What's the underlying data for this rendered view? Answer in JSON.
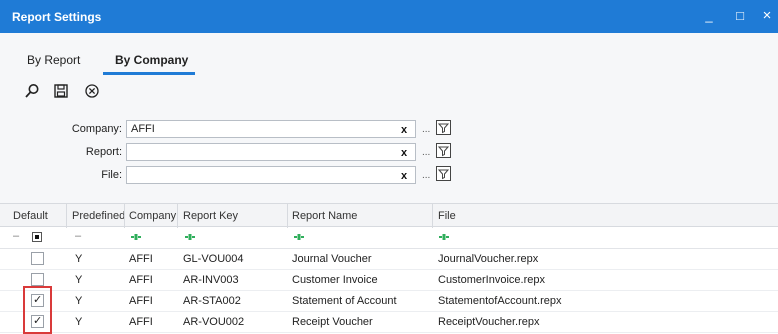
{
  "window": {
    "title": "Report Settings",
    "controls": {
      "minimize": "_",
      "maximize": "□",
      "close": "×"
    }
  },
  "tabs": [
    {
      "label": "By Report",
      "active": false
    },
    {
      "label": "By Company",
      "active": true
    }
  ],
  "toolbar": {
    "icons": [
      "search-icon",
      "save-icon",
      "cancel-icon"
    ]
  },
  "form": {
    "company": {
      "label": "Company:",
      "value": "AFFI"
    },
    "report": {
      "label": "Report:",
      "value": ""
    },
    "file": {
      "label": "File:",
      "value": ""
    },
    "clear_label": "x",
    "dots_label": "..."
  },
  "grid": {
    "columns": [
      "Default",
      "Predefined",
      "Company",
      "Report Key",
      "Report Name",
      "File"
    ],
    "filter_row": {
      "default_dash": "–",
      "predefined_dash": "–"
    },
    "rows": [
      {
        "default_checked": false,
        "predefined": "Y",
        "company": "AFFI",
        "report_key": "GL-VOU004",
        "report_name": "Journal Voucher",
        "file": "JournalVoucher.repx"
      },
      {
        "default_checked": false,
        "predefined": "Y",
        "company": "AFFI",
        "report_key": "AR-INV003",
        "report_name": "Customer Invoice",
        "file": "CustomerInvoice.repx"
      },
      {
        "default_checked": true,
        "predefined": "Y",
        "company": "AFFI",
        "report_key": "AR-STA002",
        "report_name": "Statement of Account",
        "file": "StatementofAccount.repx"
      },
      {
        "default_checked": true,
        "predefined": "Y",
        "company": "AFFI",
        "report_key": "AR-VOU002",
        "report_name": "Receipt Voucher",
        "file": "ReceiptVoucher.repx"
      }
    ]
  },
  "colors": {
    "titlebar": "#1f7bd6",
    "highlight": "#d93a3a",
    "filter_icon": "#2fae5b"
  }
}
